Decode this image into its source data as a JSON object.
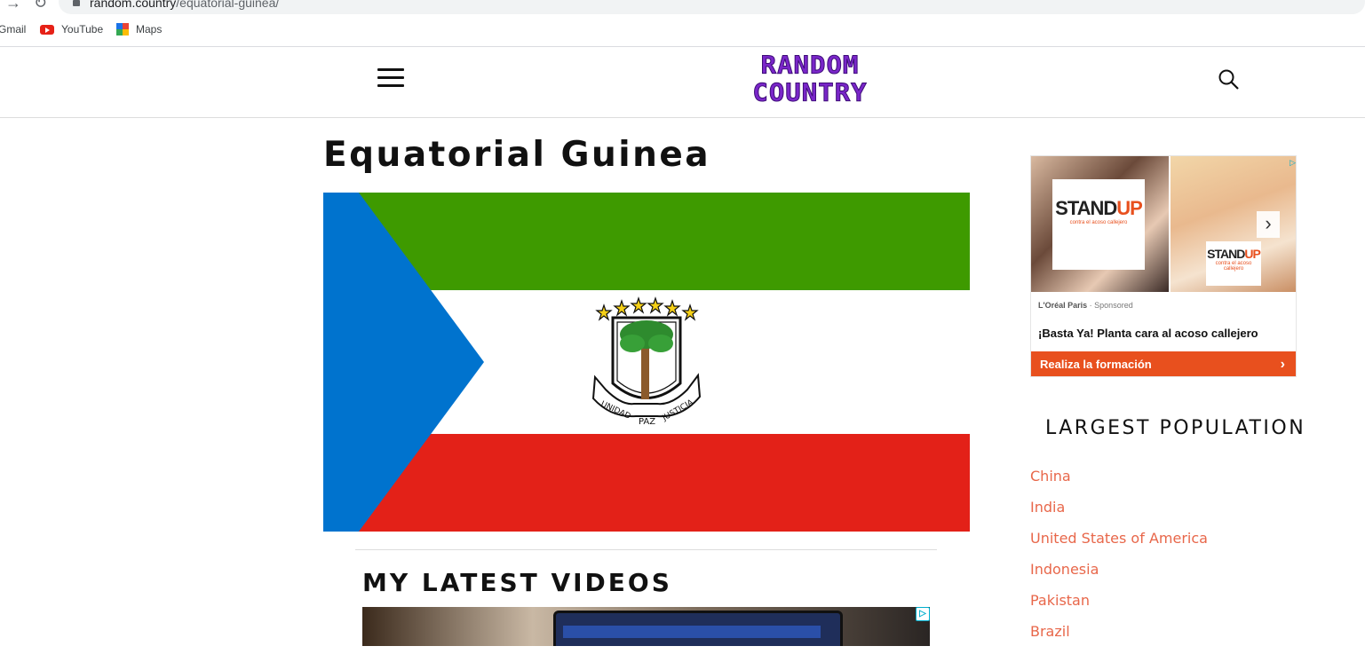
{
  "browser": {
    "url_host": "random.country",
    "url_path": "/equatorial-guinea/",
    "bookmarks": [
      {
        "label": "Gmail",
        "icon": "gmail-icon"
      },
      {
        "label": "YouTube",
        "icon": "youtube-icon"
      },
      {
        "label": "Maps",
        "icon": "maps-icon"
      }
    ]
  },
  "header": {
    "logo_line1": "RANDOM",
    "logo_line2": "COUNTRY",
    "logo_color": "#7a26c9"
  },
  "main": {
    "page_title": "Equatorial Guinea",
    "flag_colors": {
      "green": "#3e9a00",
      "white": "#ffffff",
      "red": "#e32118",
      "blue": "#0073ce"
    },
    "emblem_scroll_text": [
      "UNIDAD",
      "PAZ",
      "JUSTICIA"
    ],
    "videos_heading": "MY LATEST VIDEOS"
  },
  "ad": {
    "headline_brand": "STAND",
    "headline_brand_accent": "UP",
    "subtitle": "contra el acoso callejero",
    "advertiser": "L'Oréal Paris",
    "sponsored": "Sponsored",
    "title": "¡Basta Ya! Planta cara al acoso callejero",
    "cta": "Realiza la formación",
    "cta_color": "#e8501e"
  },
  "sidebar": {
    "heading": "LARGEST POPULATION",
    "countries": [
      "China",
      "India",
      "United States of America",
      "Indonesia",
      "Pakistan",
      "Brazil"
    ]
  }
}
